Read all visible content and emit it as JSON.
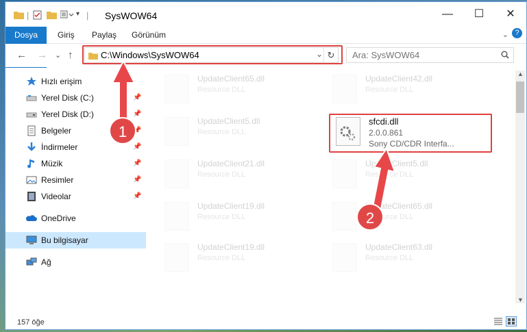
{
  "window": {
    "title": "SysWOW64",
    "minimize": "—",
    "maximize": "☐",
    "close": "✕",
    "help": "?"
  },
  "ribbon": {
    "tabs": [
      "Dosya",
      "Giriş",
      "Paylaş",
      "Görünüm"
    ]
  },
  "navigation": {
    "back": "←",
    "forward": "→",
    "recent": "⌄",
    "up": "↑",
    "address": "C:\\Windows\\SysWOW64",
    "refresh": "↻",
    "search_placeholder": "Ara: SysWOW64"
  },
  "sidebar": {
    "items": [
      {
        "label": "Hızlı erişim",
        "icon": "star-icon"
      },
      {
        "label": "Yerel Disk (C:)",
        "icon": "drive-icon",
        "pinned": true
      },
      {
        "label": "Yerel Disk (D:)",
        "icon": "drive-icon",
        "pinned": true
      },
      {
        "label": "Belgeler",
        "icon": "documents-icon",
        "pinned": true
      },
      {
        "label": "İndirmeler",
        "icon": "downloads-icon",
        "pinned": true
      },
      {
        "label": "Müzik",
        "icon": "music-icon",
        "pinned": true
      },
      {
        "label": "Resimler",
        "icon": "pictures-icon",
        "pinned": true
      },
      {
        "label": "Videolar",
        "icon": "videos-icon",
        "pinned": true
      },
      {
        "label": "OneDrive",
        "icon": "cloud-icon"
      },
      {
        "label": "Bu bilgisayar",
        "icon": "computer-icon",
        "selected": true
      },
      {
        "label": "Ağ",
        "icon": "network-icon"
      }
    ]
  },
  "files": [
    {
      "name": "UpdateClient65.dll",
      "type": "Resource DLL"
    },
    {
      "name": "UpdateClient42.dll",
      "type": "Resource DLL"
    },
    {
      "name": "UpdateClient5.dll",
      "type": "Resource DLL"
    },
    {
      "name": "sfcdi.dll",
      "version": "2.0.0.861",
      "description": "Sony CD/CDR Interfa..."
    },
    {
      "name": "UpdateClient21.dll",
      "type": "Resource DLL"
    },
    {
      "name": "UpdateClient5.dll",
      "type": "Resource DLL"
    },
    {
      "name": "UpdateClient19.dll",
      "type": "Resource DLL"
    },
    {
      "name": "UpdateClient65.dll",
      "type": "Resource DLL"
    },
    {
      "name": "UpdateClient19.dll",
      "type": "Resource DLL"
    },
    {
      "name": "UpdateClient63.dll",
      "type": "Resource DLL"
    }
  ],
  "status": {
    "item_count": "157 öğe"
  },
  "annotations": {
    "step1": "1",
    "step2": "2"
  },
  "colors": {
    "accent": "#1979ca",
    "highlight_box": "#e04040",
    "arrow": "#e8474a",
    "selection": "#cce8ff"
  }
}
